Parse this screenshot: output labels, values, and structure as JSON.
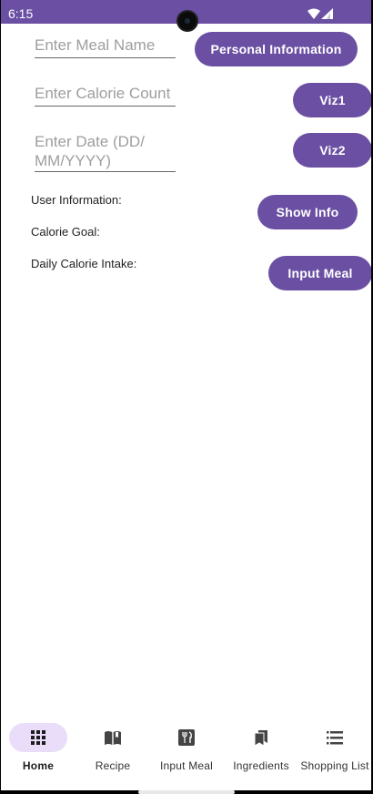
{
  "status_bar": {
    "time": "6:15",
    "background": "#6a4fa3",
    "icons": [
      "wifi-icon",
      "signal-icon"
    ]
  },
  "form": {
    "meal_name": {
      "placeholder": "Enter Meal Name",
      "value": ""
    },
    "calorie_count": {
      "placeholder": "Enter Calorie Count",
      "value": ""
    },
    "date": {
      "placeholder": "Enter Date (DD/MM/YYYY)",
      "placeholder_lines": [
        "Enter Date (DD/",
        "MM/YYYY)"
      ],
      "value": ""
    }
  },
  "buttons": {
    "personal_information": "Personal Information",
    "viz1": "Viz1",
    "viz2": "Viz2",
    "show_info": "Show Info",
    "input_meal": "Input Meal"
  },
  "labels": {
    "user_information": "User Information:",
    "calorie_goal": "Calorie Goal:",
    "daily_calorie_intake": "Daily Calorie Intake:"
  },
  "bottom_nav": {
    "active": "Home",
    "items": [
      {
        "label": "Home",
        "icon": "grid-icon"
      },
      {
        "label": "Recipe",
        "icon": "book-icon"
      },
      {
        "label": "Input Meal",
        "icon": "restaurant-icon"
      },
      {
        "label": "Ingredients",
        "icon": "bookmarks-icon"
      },
      {
        "label": "Shopping List",
        "icon": "list-icon"
      }
    ]
  },
  "colors": {
    "primary": "#6a4fa3",
    "active_indicator": "#e9ddfa",
    "placeholder": "#9e9e9e"
  }
}
